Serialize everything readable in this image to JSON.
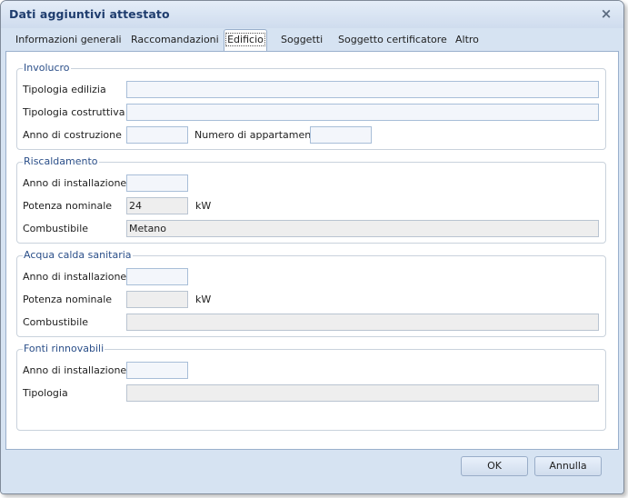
{
  "window": {
    "title": "Dati aggiuntivi attestato",
    "close_glyph": "×"
  },
  "tabs": [
    {
      "label": "Informazioni generali"
    },
    {
      "label": "Raccomandazioni"
    },
    {
      "label": "Edificio"
    },
    {
      "label": "Soggetti"
    },
    {
      "label": "Soggetto certificatore"
    },
    {
      "label": "Altro"
    }
  ],
  "active_tab": "Edificio",
  "involucro": {
    "title": "Involucro",
    "tipologia_edilizia": {
      "label": "Tipologia edilizia",
      "value": ""
    },
    "tipologia_costruttiva": {
      "label": "Tipologia costruttiva",
      "value": ""
    },
    "anno_costruzione": {
      "label": "Anno di costruzione",
      "value": ""
    },
    "numero_appartamenti": {
      "label": "Numero di appartamenti",
      "value": ""
    }
  },
  "riscaldamento": {
    "title": "Riscaldamento",
    "anno_installazione": {
      "label": "Anno di installazione",
      "value": ""
    },
    "potenza_nominale": {
      "label": "Potenza nominale",
      "value": "24",
      "unit": "kW"
    },
    "combustibile": {
      "label": "Combustibile",
      "value": "Metano"
    }
  },
  "acqua_calda": {
    "title": "Acqua calda sanitaria",
    "anno_installazione": {
      "label": "Anno di installazione",
      "value": ""
    },
    "potenza_nominale": {
      "label": "Potenza nominale",
      "value": "",
      "unit": "kW"
    },
    "combustibile": {
      "label": "Combustibile",
      "value": ""
    }
  },
  "fonti_rinnovabili": {
    "title": "Fonti rinnovabili",
    "anno_installazione": {
      "label": "Anno di installazione",
      "value": ""
    },
    "tipologia": {
      "label": "Tipologia",
      "value": ""
    }
  },
  "buttons": {
    "ok": "OK",
    "cancel": "Annulla"
  },
  "colors": {
    "accent_title": "#1f3d6e",
    "group_title": "#2b4f89",
    "frame_bg": "#d6e3f2"
  }
}
